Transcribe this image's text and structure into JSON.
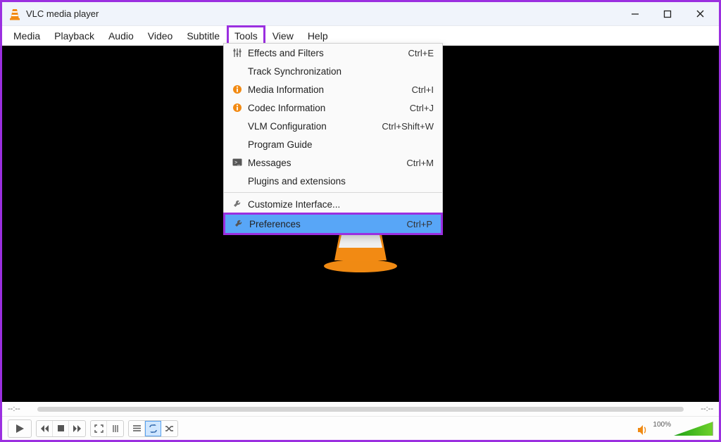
{
  "window": {
    "title": "VLC media player"
  },
  "menubar": {
    "items": [
      "Media",
      "Playback",
      "Audio",
      "Video",
      "Subtitle",
      "Tools",
      "View",
      "Help"
    ]
  },
  "tools_menu": {
    "effects": {
      "label": "Effects and Filters",
      "shortcut": "Ctrl+E"
    },
    "tracksync": {
      "label": "Track Synchronization",
      "shortcut": ""
    },
    "mediainfo": {
      "label": "Media Information",
      "shortcut": "Ctrl+I"
    },
    "codecinfo": {
      "label": "Codec Information",
      "shortcut": "Ctrl+J"
    },
    "vlmconfig": {
      "label": "VLM Configuration",
      "shortcut": "Ctrl+Shift+W"
    },
    "progguide": {
      "label": "Program Guide",
      "shortcut": ""
    },
    "messages": {
      "label": "Messages",
      "shortcut": "Ctrl+M"
    },
    "plugins": {
      "label": "Plugins and extensions",
      "shortcut": ""
    },
    "customize": {
      "label": "Customize Interface...",
      "shortcut": ""
    },
    "prefs": {
      "label": "Preferences",
      "shortcut": "Ctrl+P"
    }
  },
  "seek": {
    "elapsed": "--:--",
    "remaining": "--:--"
  },
  "volume": {
    "percent": "100%"
  }
}
